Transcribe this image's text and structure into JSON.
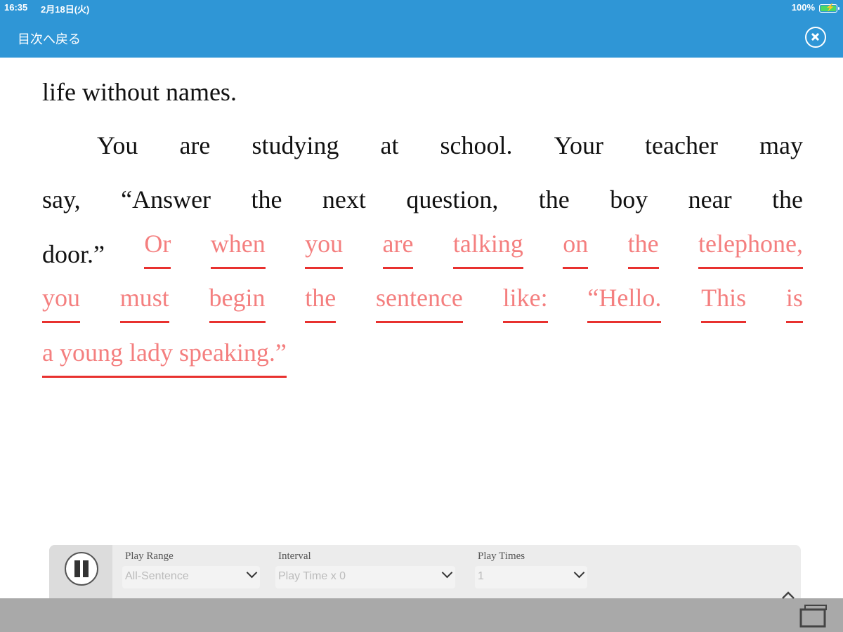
{
  "status_bar": {
    "time": "16:35",
    "date": "2月18日(火)",
    "battery": "100%"
  },
  "nav": {
    "back_label": "目次へ戻る",
    "close_icon": "close-circle-icon"
  },
  "text": {
    "lines": [
      [
        {
          "t": "life without names.",
          "h": false
        }
      ],
      [
        {
          "t": "You",
          "h": false
        },
        {
          "t": "are",
          "h": false
        },
        {
          "t": "studying",
          "h": false
        },
        {
          "t": "at",
          "h": false
        },
        {
          "t": "school.",
          "h": false
        },
        {
          "t": "Your",
          "h": false
        },
        {
          "t": "teacher",
          "h": false
        },
        {
          "t": "may",
          "h": false
        }
      ],
      [
        {
          "t": "say,",
          "h": false
        },
        {
          "t": "“Answer",
          "h": false
        },
        {
          "t": "the",
          "h": false
        },
        {
          "t": "next",
          "h": false
        },
        {
          "t": "question,",
          "h": false
        },
        {
          "t": "the",
          "h": false
        },
        {
          "t": "boy",
          "h": false
        },
        {
          "t": "near",
          "h": false
        },
        {
          "t": "the",
          "h": false
        }
      ],
      [
        {
          "t": "door.”",
          "h": false
        },
        {
          "t": "Or",
          "h": true
        },
        {
          "t": "when",
          "h": true
        },
        {
          "t": "you",
          "h": true
        },
        {
          "t": "are",
          "h": true
        },
        {
          "t": "talking",
          "h": true
        },
        {
          "t": "on",
          "h": true
        },
        {
          "t": "the",
          "h": true
        },
        {
          "t": "telephone,",
          "h": true
        }
      ],
      [
        {
          "t": "you",
          "h": true
        },
        {
          "t": "must",
          "h": true
        },
        {
          "t": "begin",
          "h": true
        },
        {
          "t": "the",
          "h": true
        },
        {
          "t": "sentence",
          "h": true
        },
        {
          "t": "like:",
          "h": true
        },
        {
          "t": "“Hello.",
          "h": true
        },
        {
          "t": "This",
          "h": true
        },
        {
          "t": "is",
          "h": true
        }
      ],
      [
        {
          "t": "a young lady speaking.”",
          "h": true
        }
      ]
    ],
    "highlight_color": "#f47f7f",
    "underline_color": "#e8312f"
  },
  "controls": {
    "pause_icon": "pause-icon",
    "play_range_label": "Play Range",
    "play_range_value": "All-Sentence",
    "interval_label": "Interval",
    "interval_value": "Play Time x 0",
    "play_times_label": "Play Times",
    "play_times_value": "1"
  },
  "colors": {
    "header": "#2f96d6",
    "bottom_bar": "#a9a9a9"
  }
}
